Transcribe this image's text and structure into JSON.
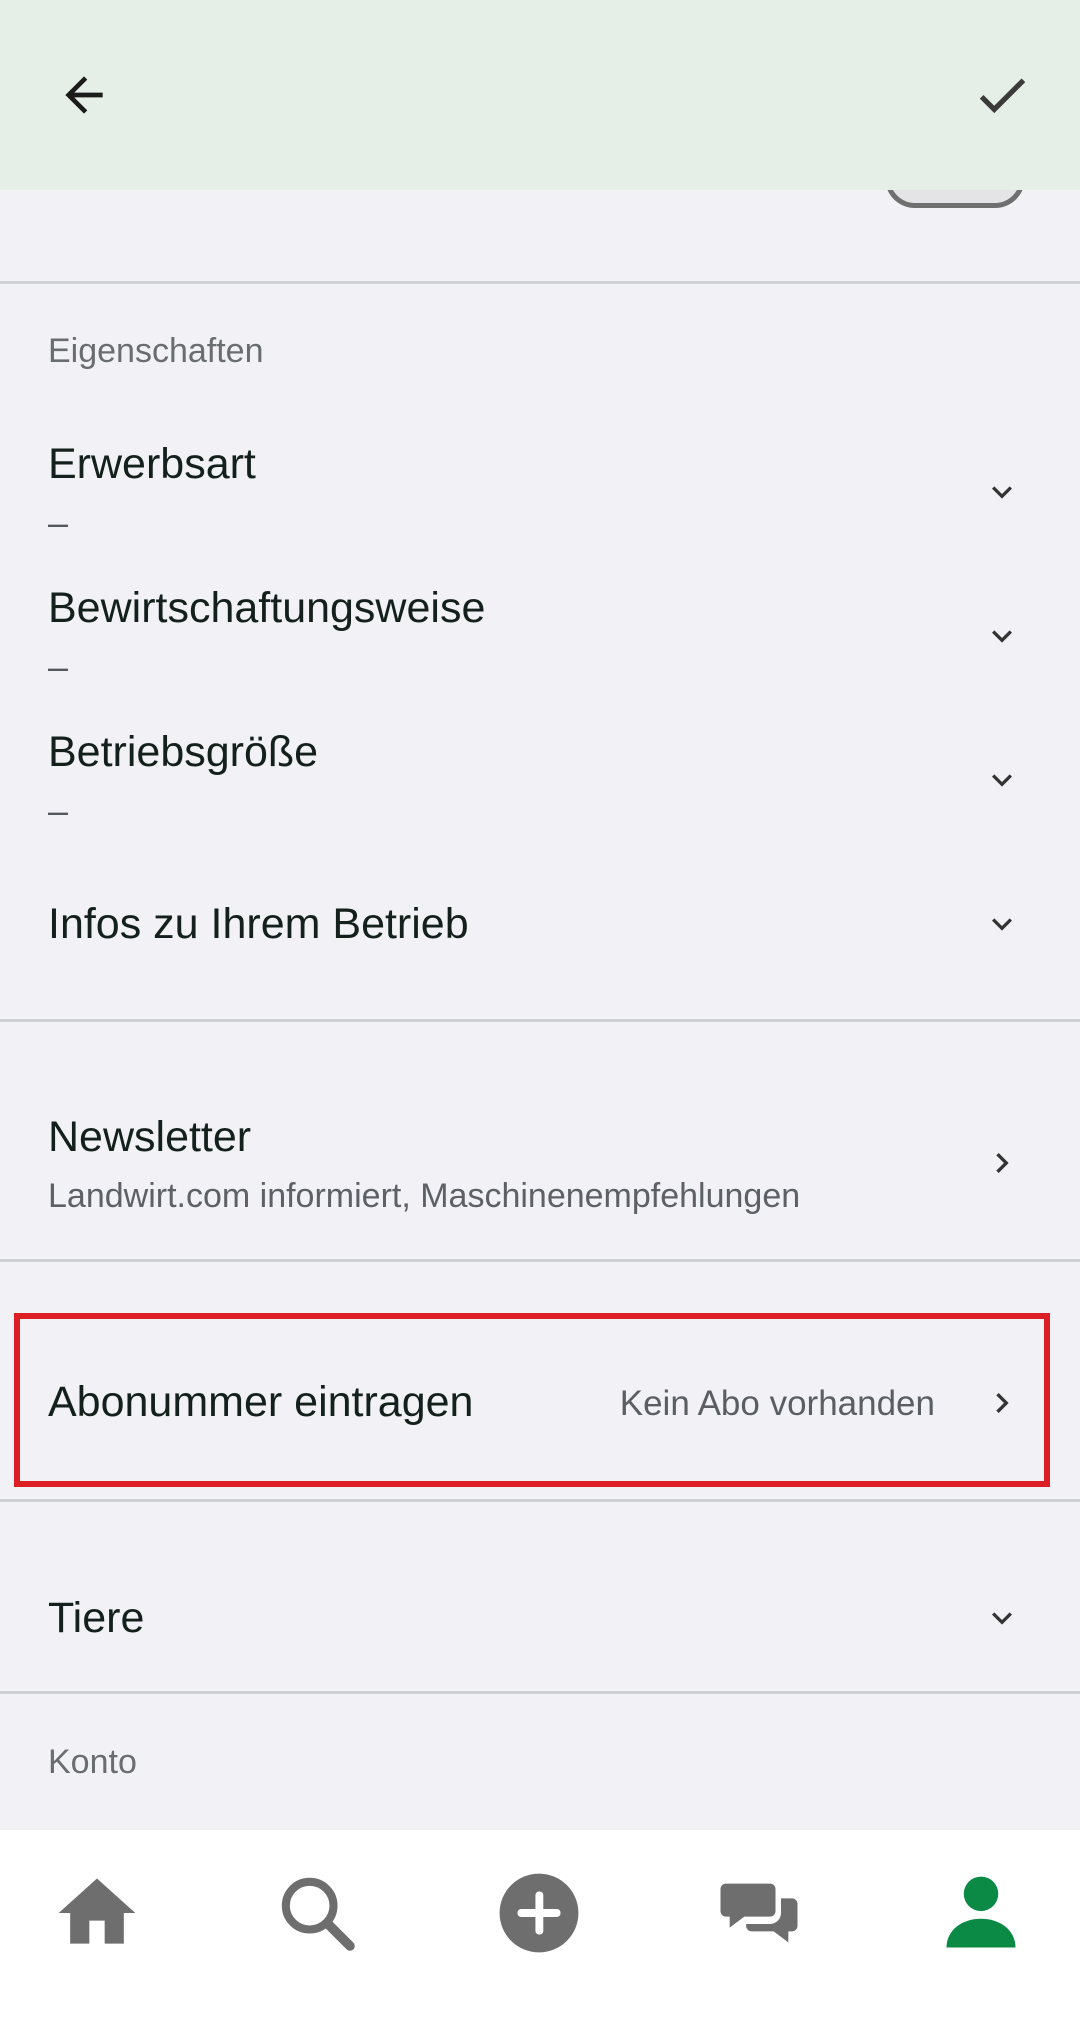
{
  "header": {
    "back_icon": "arrow-left-icon",
    "confirm_icon": "checkmark-icon"
  },
  "properties": {
    "section_label": "Eigenschaften",
    "items": [
      {
        "title": "Erwerbsart",
        "value": "–"
      },
      {
        "title": "Bewirtschaftungsweise",
        "value": "–"
      },
      {
        "title": "Betriebsgröße",
        "value": "–"
      },
      {
        "title": "Infos zu Ihrem Betrieb"
      }
    ]
  },
  "newsletter": {
    "title": "Newsletter",
    "subtitle": "Landwirt.com informiert, Maschinenempfehlungen"
  },
  "subscription": {
    "title": "Abonummer eintragen",
    "value": "Kein Abo vorhanden"
  },
  "animals": {
    "title": "Tiere"
  },
  "account": {
    "section_label": "Konto"
  },
  "bottom_nav": {
    "items": [
      "home-icon",
      "search-icon",
      "add-icon",
      "chat-icon",
      "profile-icon"
    ],
    "active": "profile-icon",
    "active_color": "#0a8a45",
    "inactive_color": "#6e6e6e"
  },
  "colors": {
    "header_bg": "#e6efe7",
    "highlight_border": "#dc1e25"
  }
}
